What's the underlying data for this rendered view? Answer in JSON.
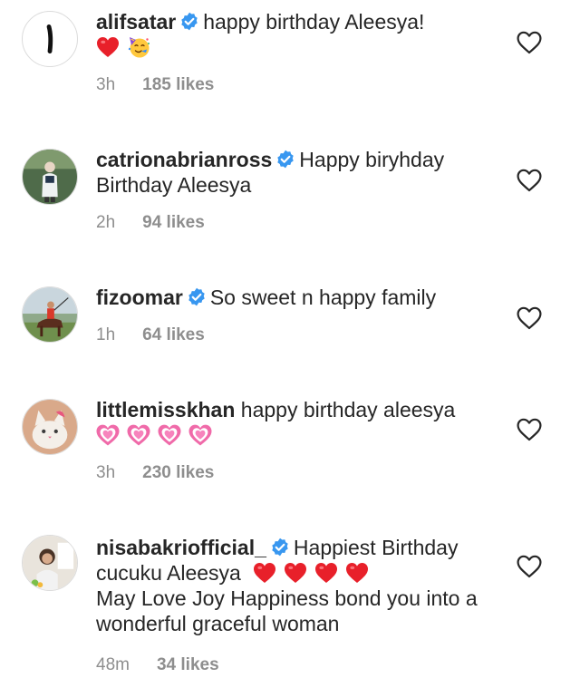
{
  "comments": [
    {
      "username": "alifsatar",
      "verified": true,
      "text": "happy birthday Aleesya!",
      "emojis": [
        "red-heart-emoji",
        "partying-face-emoji"
      ],
      "time": "3h",
      "likes": "185 likes"
    },
    {
      "username": "catrionabrianross",
      "verified": true,
      "text": "Happy biryhday Birthday Aleesya",
      "time": "2h",
      "likes": "94 likes"
    },
    {
      "username": "fizoomar",
      "verified": true,
      "text": "So sweet n happy family",
      "time": "1h",
      "likes": "64 likes"
    },
    {
      "username": "littlemisskhan",
      "verified": false,
      "text": "happy birthday aleesya",
      "emojis": [
        "growing-heart-emoji",
        "growing-heart-emoji",
        "growing-heart-emoji",
        "growing-heart-emoji"
      ],
      "time": "3h",
      "likes": "230 likes"
    },
    {
      "username": "nisabakriofficial_",
      "verified": true,
      "text_1": "Happiest Birthday cucuku Aleesya",
      "emojis": [
        "red-heart-emoji",
        "red-heart-emoji",
        "red-heart-emoji",
        "red-heart-emoji"
      ],
      "text_2": "May Love Joy Happiness bond you into a wonderful graceful woman",
      "time": "48m",
      "likes": "34 likes"
    }
  ],
  "colors": {
    "verified_blue": "#3897f0",
    "meta_gray": "#8e8e8e",
    "text": "#262626",
    "red_heart": "#e8202a",
    "pink_heart": "#f06aa9"
  }
}
